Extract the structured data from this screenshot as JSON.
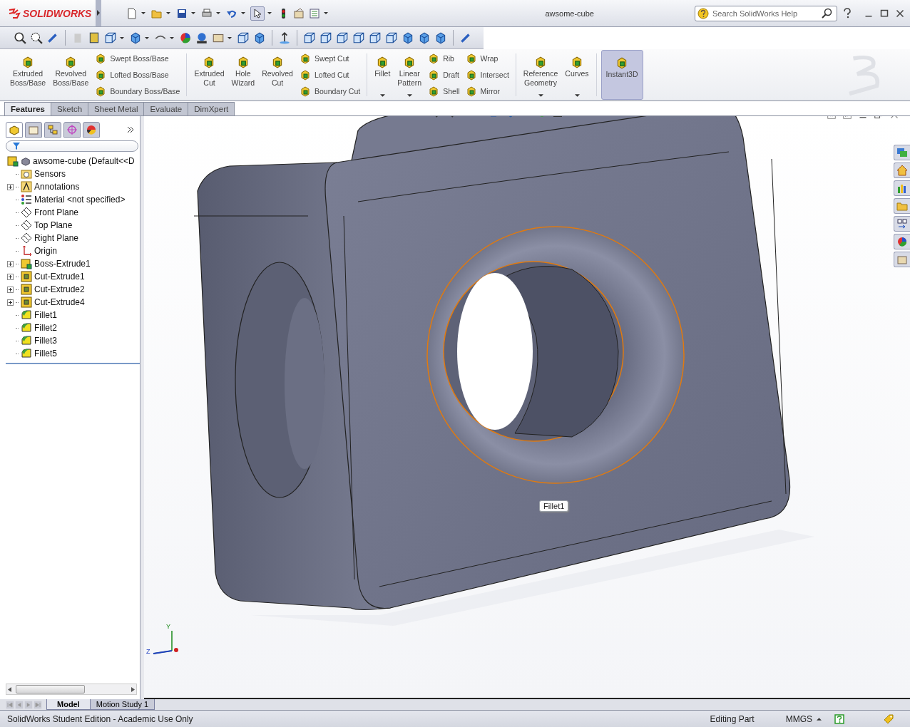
{
  "window": {
    "logo": "SOLIDWORKS",
    "title": "awsome-cube"
  },
  "search": {
    "placeholder": "Search SolidWorks Help"
  },
  "ribbon": {
    "groups": [
      {
        "items": [
          {
            "kind": "large",
            "label": [
              "Extruded",
              "Boss/Base"
            ],
            "dropdown": false,
            "on": false
          },
          {
            "kind": "large",
            "label": [
              "Revolved",
              "Boss/Base"
            ],
            "dropdown": false,
            "on": false
          },
          {
            "kind": "column",
            "labels": [
              "Swept Boss/Base",
              "Lofted Boss/Base",
              "Boundary Boss/Base"
            ]
          }
        ]
      },
      {
        "items": [
          {
            "kind": "large",
            "label": [
              "Extruded",
              "Cut"
            ],
            "dropdown": false,
            "on": false
          },
          {
            "kind": "large",
            "label": [
              "Hole",
              "Wizard"
            ],
            "dropdown": false,
            "on": false
          },
          {
            "kind": "large",
            "label": [
              "Revolved",
              "Cut"
            ],
            "dropdown": false,
            "on": false
          },
          {
            "kind": "column",
            "labels": [
              "Swept Cut",
              "Lofted Cut",
              "Boundary Cut"
            ]
          }
        ]
      },
      {
        "items": [
          {
            "kind": "large",
            "label": [
              "Fillet"
            ],
            "dropdown": true,
            "on": false
          },
          {
            "kind": "large",
            "label": [
              "Linear",
              "Pattern"
            ],
            "dropdown": true,
            "on": false
          },
          {
            "kind": "column",
            "labels": [
              "Rib",
              "Draft",
              "Shell"
            ]
          },
          {
            "kind": "column",
            "labels": [
              "Wrap",
              "Intersect",
              "Mirror"
            ]
          }
        ]
      },
      {
        "items": [
          {
            "kind": "large",
            "label": [
              "Reference",
              "Geometry"
            ],
            "dropdown": true,
            "on": false
          },
          {
            "kind": "large",
            "label": [
              "Curves"
            ],
            "dropdown": true,
            "on": false
          }
        ]
      },
      {
        "items": [
          {
            "kind": "large",
            "label": [
              "Instant3D"
            ],
            "dropdown": false,
            "on": true
          }
        ]
      }
    ]
  },
  "command_tabs": [
    {
      "label": "Features",
      "selected": true
    },
    {
      "label": "Sketch",
      "selected": false
    },
    {
      "label": "Sheet Metal",
      "selected": false
    },
    {
      "label": "Evaluate",
      "selected": false
    },
    {
      "label": "DimXpert",
      "selected": false
    }
  ],
  "feature_tree": {
    "root": "awsome-cube  (Default<<D",
    "items": [
      {
        "label": "Sensors",
        "kind": "sensors",
        "collapsible": false
      },
      {
        "label": "Annotations",
        "kind": "annotations",
        "collapsible": true
      },
      {
        "label": "Material <not specified>",
        "kind": "material",
        "collapsible": false
      },
      {
        "label": "Front Plane",
        "kind": "plane",
        "collapsible": false
      },
      {
        "label": "Top Plane",
        "kind": "plane",
        "collapsible": false
      },
      {
        "label": "Right Plane",
        "kind": "plane",
        "collapsible": false
      },
      {
        "label": "Origin",
        "kind": "origin",
        "collapsible": false
      },
      {
        "label": "Boss-Extrude1",
        "kind": "extrude",
        "collapsible": true
      },
      {
        "label": "Cut-Extrude1",
        "kind": "cut",
        "collapsible": true
      },
      {
        "label": "Cut-Extrude2",
        "kind": "cut",
        "collapsible": true
      },
      {
        "label": "Cut-Extrude4",
        "kind": "cut",
        "collapsible": true
      },
      {
        "label": "Fillet1",
        "kind": "fillet",
        "collapsible": false
      },
      {
        "label": "Fillet2",
        "kind": "fillet",
        "collapsible": false
      },
      {
        "label": "Fillet3",
        "kind": "fillet",
        "collapsible": false
      },
      {
        "label": "Fillet5",
        "kind": "fillet",
        "collapsible": false
      }
    ]
  },
  "viewport": {
    "tag": "Fillet1",
    "axis_labels": [
      "Y",
      "Z"
    ]
  },
  "bottom_tabs": [
    {
      "label": "Model",
      "selected": true
    },
    {
      "label": "Motion Study 1",
      "selected": false
    }
  ],
  "status_bar": {
    "message": "SolidWorks Student Edition - Academic Use Only",
    "mode": "Editing Part",
    "units": "MMGS"
  }
}
